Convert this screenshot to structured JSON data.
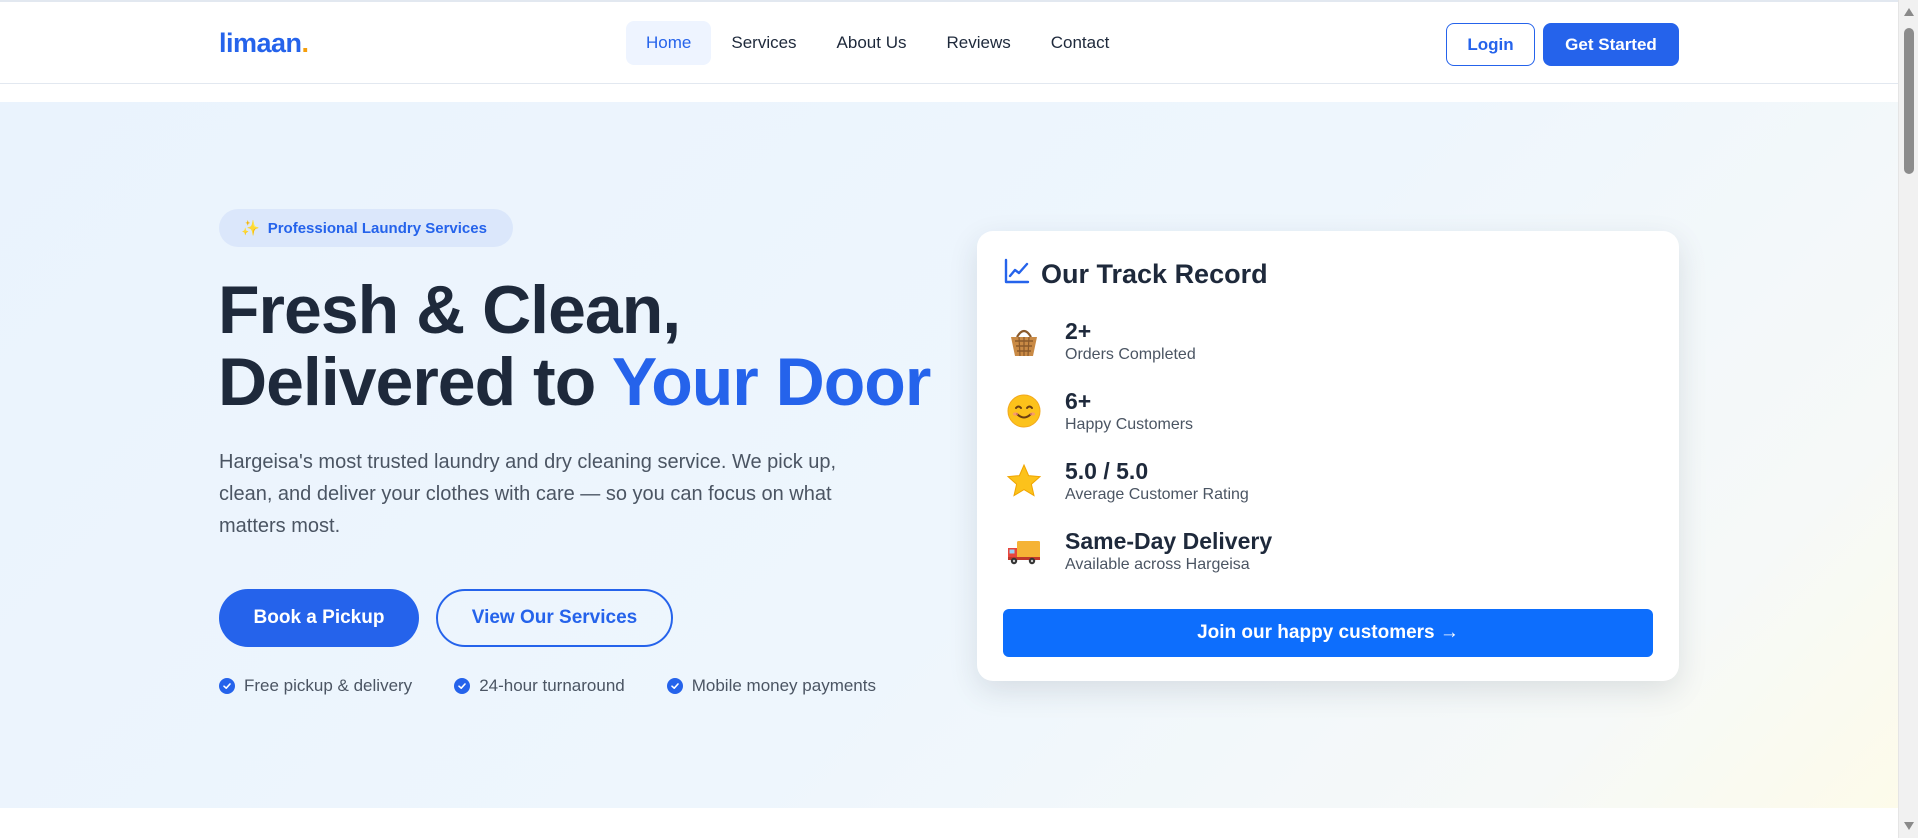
{
  "header": {
    "logo_text": "limaan",
    "logo_dot": ".",
    "nav": [
      {
        "label": "Home",
        "active": true
      },
      {
        "label": "Services",
        "active": false
      },
      {
        "label": "About Us",
        "active": false
      },
      {
        "label": "Reviews",
        "active": false
      },
      {
        "label": "Contact",
        "active": false
      }
    ],
    "login_label": "Login",
    "get_started_label": "Get Started"
  },
  "hero": {
    "badge": {
      "icon": "sparkles-icon",
      "label": "Professional Laundry Services"
    },
    "title_line1": "Fresh & Clean,",
    "title_line2": "Delivered to ",
    "title_accent": "Your Door",
    "description": "Hargeisa's most trusted laundry and dry cleaning service. We pick up, clean, and deliver your clothes with care — so you can focus on what matters most.",
    "primary_cta": "Book a Pickup",
    "secondary_cta": "View Our Services",
    "features": [
      {
        "icon": "check-circle-icon",
        "label": "Free pickup & delivery"
      },
      {
        "icon": "check-circle-icon",
        "label": "24-hour turnaround"
      },
      {
        "icon": "check-circle-icon",
        "label": "Mobile money payments"
      }
    ]
  },
  "track_record": {
    "icon": "chart-line-icon",
    "title": "Our Track Record",
    "stats": [
      {
        "icon": "basket-icon",
        "value": "2+",
        "label": "Orders Completed"
      },
      {
        "icon": "smile-icon",
        "value": "6+",
        "label": "Happy Customers"
      },
      {
        "icon": "star-icon",
        "value": "5.0 / 5.0",
        "label": "Average Customer Rating"
      },
      {
        "icon": "delivery-truck-icon",
        "value": "Same-Day Delivery",
        "label": "Available across Hargeisa"
      }
    ],
    "cta": "Join our happy customers →"
  },
  "colors": {
    "brand": "#2563eb",
    "accent_dot": "#f59e0b",
    "text_dark": "#1e293b",
    "text_muted": "#4b5563",
    "card_button": "#0d6efd"
  }
}
